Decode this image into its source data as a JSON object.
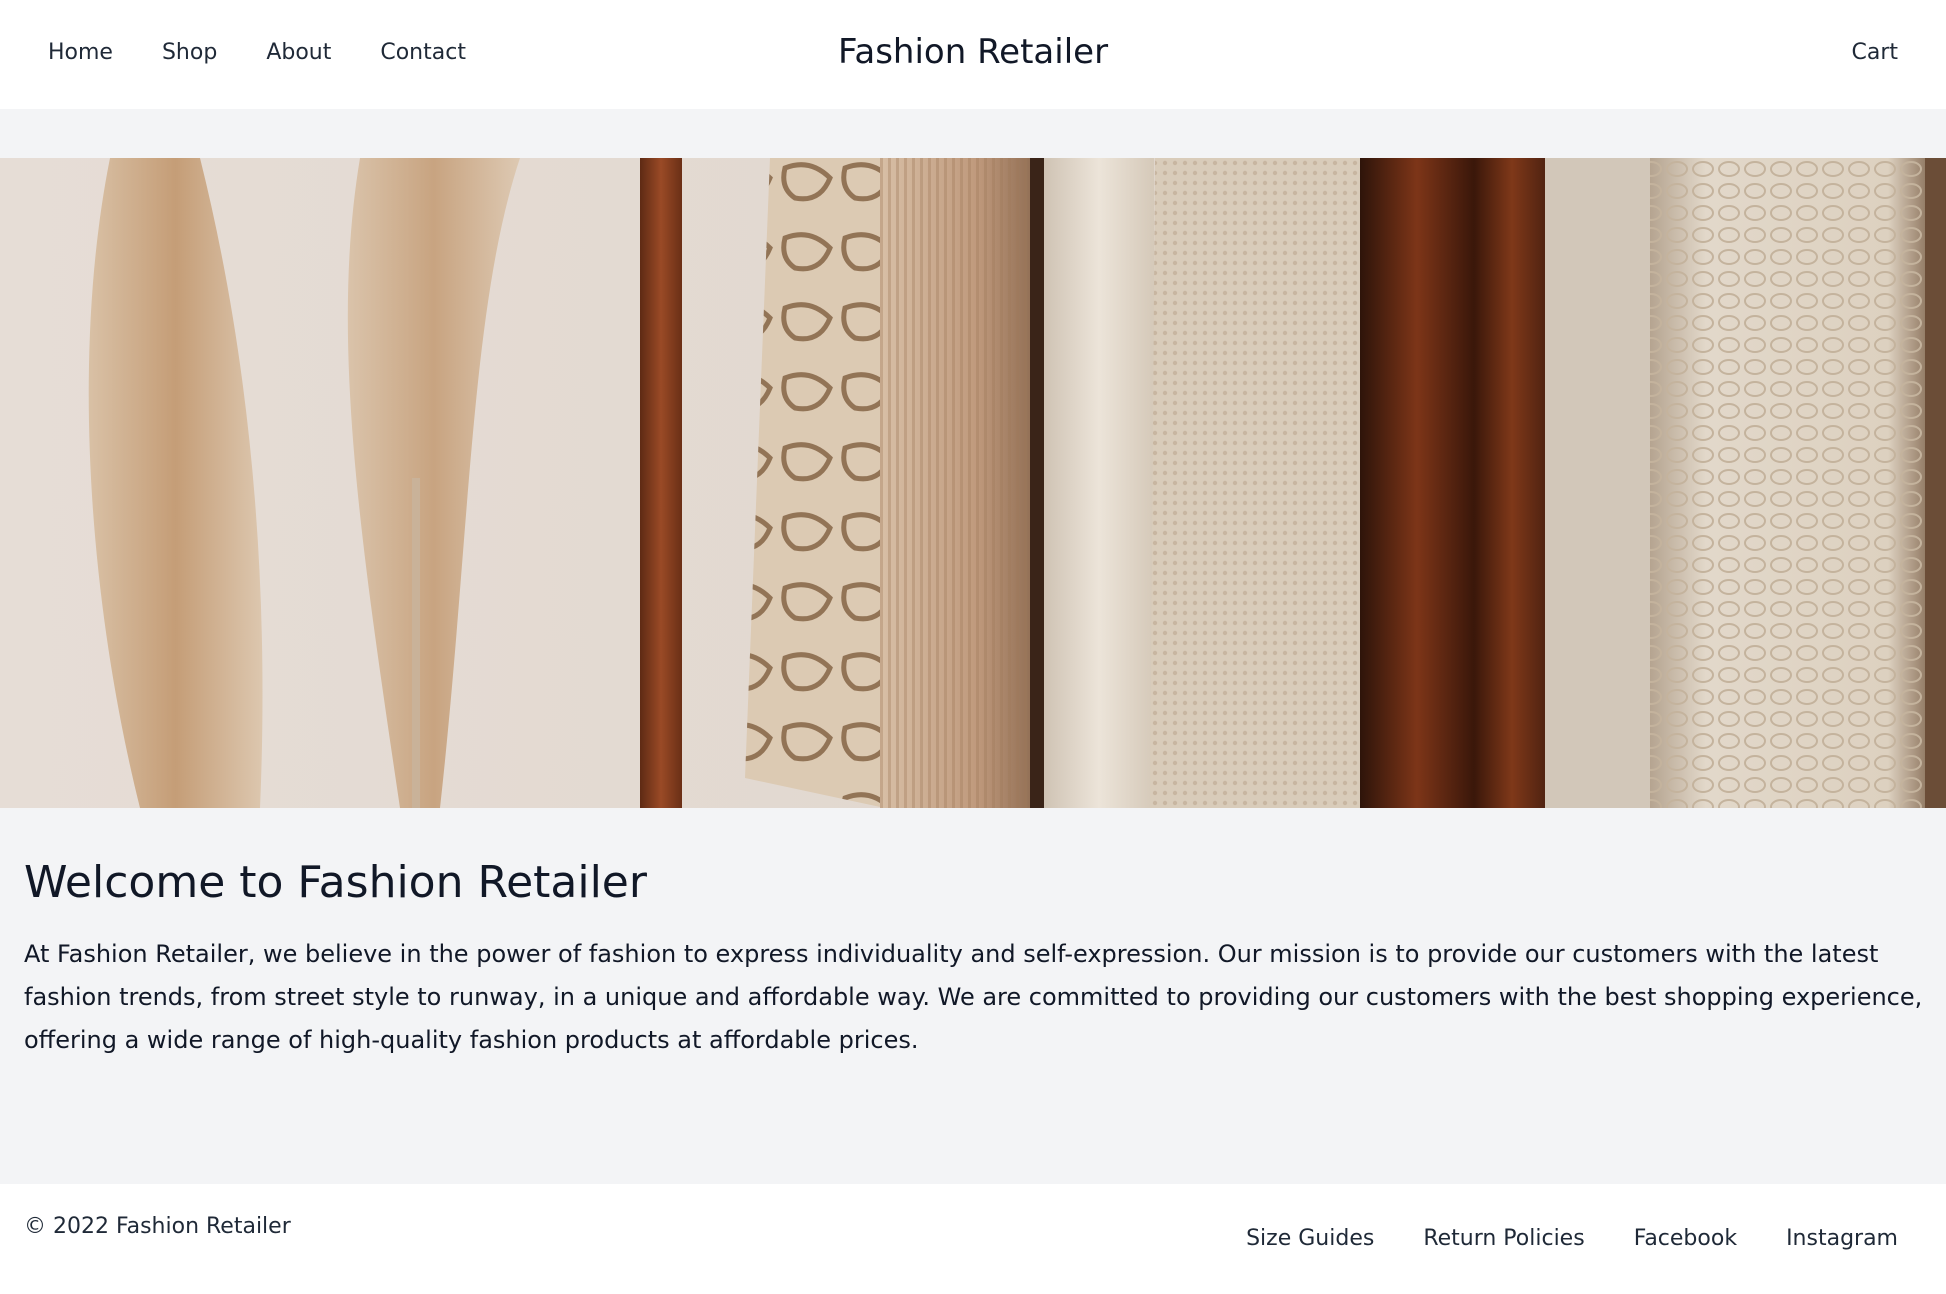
{
  "header": {
    "nav": [
      {
        "label": "Home"
      },
      {
        "label": "Shop"
      },
      {
        "label": "About"
      },
      {
        "label": "Contact"
      }
    ],
    "brand": "Fashion Retailer",
    "cart_label": "Cart"
  },
  "hero": {
    "image_description": "Neutral-toned clothing hanging on a rack beside dried pampas grass",
    "colors": {
      "wall": "#e3dad3",
      "pampas": "#c9a27a",
      "rack": "#8a3f1f",
      "snake_print": "#d9c7b0",
      "knit_tan": "#c29b7a",
      "cream": "#e8dfd2",
      "rust": "#7a3418",
      "sherpa": "#ddd2c2"
    }
  },
  "main": {
    "title": "Welcome to Fashion Retailer",
    "intro": "At Fashion Retailer, we believe in the power of fashion to express individuality and self-expression. Our mission is to provide our customers with the latest fashion trends, from street style to runway, in a unique and affordable way. We are committed to providing our customers with the best shopping experience, offering a wide range of high-quality fashion products at affordable prices."
  },
  "footer": {
    "copyright": "© 2022 Fashion Retailer",
    "links": [
      {
        "label": "Size Guides"
      },
      {
        "label": "Return Policies"
      },
      {
        "label": "Facebook"
      },
      {
        "label": "Instagram"
      }
    ]
  },
  "theme": {
    "page_bg": "#f3f4f6",
    "surface": "#ffffff",
    "text": "#1f2937"
  }
}
